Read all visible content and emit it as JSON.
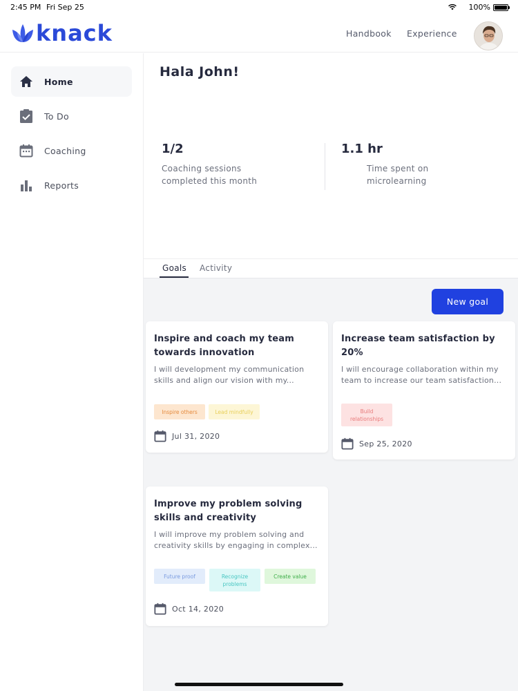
{
  "status_bar": {
    "time": "2:45 PM",
    "date": "Fri Sep 25",
    "battery": "100%"
  },
  "header": {
    "brand": "knack",
    "nav": {
      "handbook": "Handbook",
      "experience": "Experience"
    }
  },
  "sidebar": {
    "items": [
      {
        "label": "Home",
        "icon": "home-icon",
        "active": true
      },
      {
        "label": "To Do",
        "icon": "clipboard-check-icon",
        "active": false
      },
      {
        "label": "Coaching",
        "icon": "calendar-icon",
        "active": false
      },
      {
        "label": "Reports",
        "icon": "bar-chart-icon",
        "active": false
      }
    ]
  },
  "main": {
    "greeting": "Hala John!",
    "stats": [
      {
        "value": "1/2",
        "desc_line1": "Coaching sessions",
        "desc_line2": "completed this month"
      },
      {
        "value": "1.1 hr",
        "desc_line1": "Time spent on",
        "desc_line2": "microlearning"
      }
    ],
    "tabs": {
      "goals": "Goals",
      "activity": "Activity"
    },
    "new_goal_label": "New goal",
    "goals": [
      {
        "title_line1": "Inspire and coach my team",
        "title_line2": "towards innovation",
        "body_line1": "I will development my communication",
        "body_line2": "skills and align our vision with my...",
        "tags": [
          {
            "label": "Inspire others",
            "bg": "#fde6cf",
            "color": "#e58a3c"
          },
          {
            "label": "Lead mindfully",
            "bg": "#fdf6d6",
            "color": "#e8cf5a"
          }
        ],
        "date": "Jul 31, 2020"
      },
      {
        "title_line1": "Increase team satisfaction by",
        "title_line2": "20%",
        "body_line1": "I will encourage collaboration within my",
        "body_line2": "team to increase our team satisfaction...",
        "tags": [
          {
            "label_line1": "Build",
            "label_line2": "relationships",
            "bg": "#fde2e2",
            "color": "#e87a7a"
          }
        ],
        "date": "Sep 25, 2020"
      },
      {
        "title_line1": "Improve my problem solving",
        "title_line2": "skills and creativity",
        "body_line1": "I will improve my problem solving and",
        "body_line2": "creativity skills by engaging in complex...",
        "tags": [
          {
            "label": "Future proof",
            "bg": "#e2ecfb",
            "color": "#7a9be0"
          },
          {
            "label_line1": "Recognize",
            "label_line2": "problems",
            "bg": "#dcf8f7",
            "color": "#48c6c2"
          },
          {
            "label": "Create value",
            "bg": "#dff7dc",
            "color": "#3fae49"
          }
        ],
        "date": "Oct 14, 2020"
      }
    ]
  },
  "colors": {
    "accent": "#2041e0",
    "brand": "#2b4ad8"
  }
}
